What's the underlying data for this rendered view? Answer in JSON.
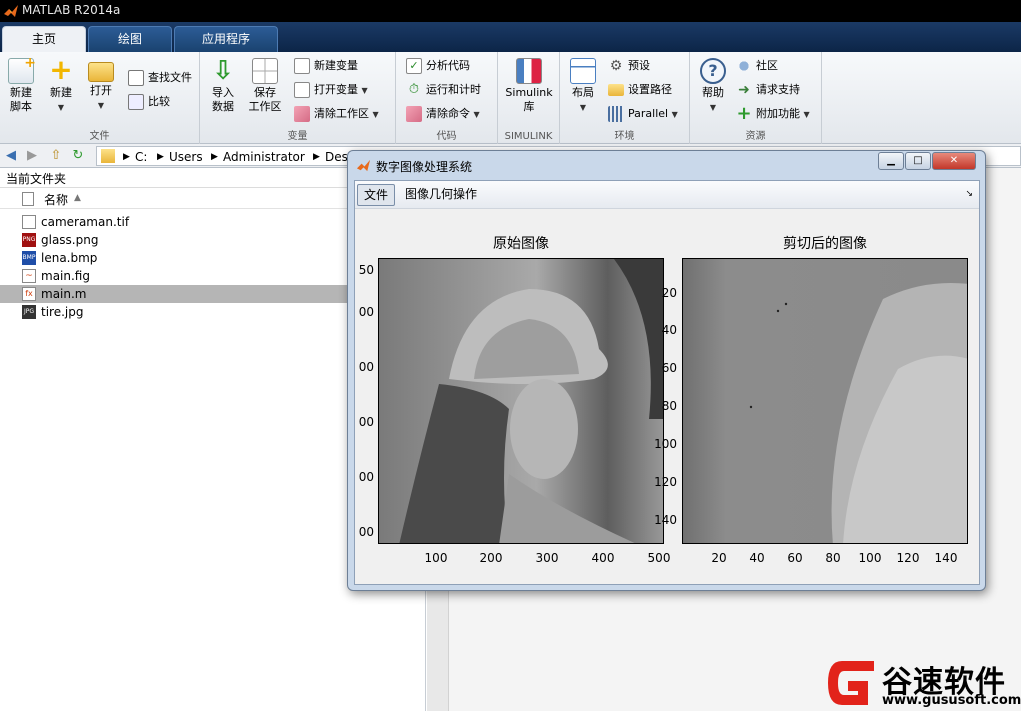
{
  "app": {
    "title": "MATLAB R2014a"
  },
  "tabs": [
    {
      "label": "主页"
    },
    {
      "label": "绘图"
    },
    {
      "label": "应用程序"
    }
  ],
  "ribbon": {
    "file": {
      "group_label": "文件",
      "new_script": "新建\n脚本",
      "new": "新建",
      "open": "打开",
      "find_files": "查找文件",
      "compare": "比较"
    },
    "variable": {
      "group_label": "变量",
      "import": "导入\n数据",
      "save_ws": "保存\n工作区",
      "new_var": "新建变量",
      "open_var": "打开变量",
      "clear_ws": "清除工作区"
    },
    "code": {
      "group_label": "代码",
      "analyze": "分析代码",
      "run_time": "运行和计时",
      "clear_cmd": "清除命令"
    },
    "simulink": {
      "group_label": "SIMULINK",
      "lib": "Simulink\n库"
    },
    "env": {
      "group_label": "环境",
      "layout": "布局",
      "prefs": "预设",
      "set_path": "设置路径",
      "parallel": "Parallel"
    },
    "resources": {
      "group_label": "资源",
      "help": "帮助",
      "community": "社区",
      "support": "请求支持",
      "addons": "附加功能"
    }
  },
  "address": {
    "crumbs": [
      "C:",
      "Users",
      "Administrator",
      "Des"
    ]
  },
  "current_folder": {
    "title": "当前文件夹",
    "column_name": "名称",
    "files": [
      {
        "name": "cameraman.tif",
        "icon": "tif-file-icon"
      },
      {
        "name": "glass.png",
        "icon": "png-file-icon"
      },
      {
        "name": "lena.bmp",
        "icon": "bmp-file-icon"
      },
      {
        "name": "main.fig",
        "icon": "fig-file-icon"
      },
      {
        "name": "main.m",
        "icon": "m-file-icon",
        "selected": true
      },
      {
        "name": "tire.jpg",
        "icon": "jpg-file-icon"
      }
    ]
  },
  "figure": {
    "title": "数字图像处理系统",
    "menus": [
      {
        "label": "文件"
      },
      {
        "label": "图像几何操作"
      }
    ],
    "axes_left": {
      "title": "原始图像",
      "xticks": [
        "100",
        "200",
        "300",
        "400",
        "500"
      ],
      "yticks": [
        "50",
        "00",
        "00",
        "00",
        "00",
        "00"
      ]
    },
    "axes_right": {
      "title": "剪切后的图像",
      "xticks": [
        "20",
        "40",
        "60",
        "80",
        "100",
        "120",
        "140"
      ],
      "yticks": [
        "20",
        "40",
        "60",
        "80",
        "100",
        "120",
        "140"
      ]
    }
  },
  "watermark": {
    "brand": "谷速软件",
    "url": "www.gususoft.com"
  }
}
